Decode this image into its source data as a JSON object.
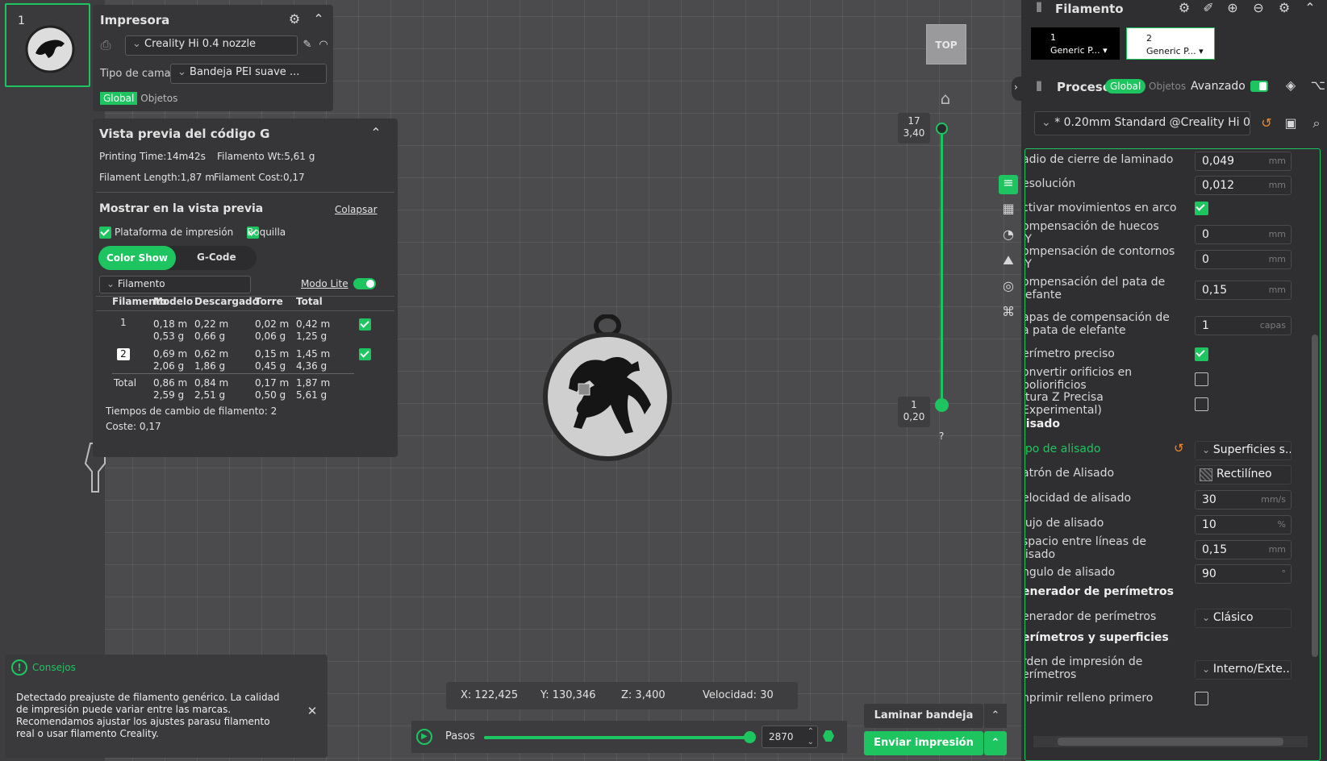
{
  "plate": {
    "number": "1"
  },
  "printer": {
    "title": "Impresora",
    "nozzle": "Creality Hi 0.4 nozzle",
    "bed_label": "Tipo de cama",
    "bed_value": "Bandeja PEI suave ...",
    "tab_global": "Global",
    "tab_objects": "Objetos"
  },
  "gcode": {
    "title": "Vista previa del código G",
    "printing_time": "Printing Time:14m42s",
    "filament_wt": "Filamento Wt:5,61 g",
    "filament_length": "Filament Length:1,87 m",
    "filament_cost": "Filament Cost:0,17",
    "show_title": "Mostrar en la vista previa",
    "collapse": "Colapsar",
    "opt_plate": "Plataforma de impresión",
    "opt_nozzle": "Boquilla",
    "tab_color": "Color Show",
    "tab_gcode": "G-Code",
    "dropdown": "Filamento",
    "lite_mode": "Modo Lite",
    "headers": [
      "Filamento",
      "Modelo",
      "Descargado",
      "Torre",
      "Total"
    ],
    "rows": [
      {
        "id": "1",
        "modelo": [
          "0,18 m",
          "0,53 g"
        ],
        "descargado": [
          "0,22 m",
          "0,66 g"
        ],
        "torre": [
          "0,02 m",
          "0,06 g"
        ],
        "total": [
          "0,42 m",
          "1,25 g"
        ]
      },
      {
        "id": "2",
        "modelo": [
          "0,69 m",
          "2,06 g"
        ],
        "descargado": [
          "0,62 m",
          "1,86 g"
        ],
        "torre": [
          "0,15 m",
          "0,45 g"
        ],
        "total": [
          "1,45 m",
          "4,36 g"
        ]
      }
    ],
    "total_row": {
      "label": "Total",
      "modelo": [
        "0,86 m",
        "2,59 g"
      ],
      "descargado": [
        "0,84 m",
        "2,51 g"
      ],
      "torre": [
        "0,17 m",
        "0,50 g"
      ],
      "total": [
        "1,87 m",
        "5,61 g"
      ]
    },
    "change_times": "Tiempos de cambio de filamento:  2",
    "cost": "Coste:  0,17"
  },
  "tips": {
    "title": "Consejos",
    "text": "Detectado preajuste de filamento genérico. La calidad de impresión puede variar entre las marcas. Recomendamos ajustar los ajustes parasu filamento real o usar filamento Creality."
  },
  "view": {
    "top_label": "TOP",
    "layer_top": [
      "17",
      "3,40"
    ],
    "layer_bottom": [
      "1",
      "0,20"
    ],
    "question": "?"
  },
  "status": {
    "x": "X: 122,425",
    "y": "Y: 130,346",
    "z": "Z: 3,400",
    "speed": "Velocidad: 30"
  },
  "steps": {
    "label": "Pasos",
    "value": "2870",
    "progress": 1.0
  },
  "actions": {
    "slice": "Laminar bandeja",
    "send": "Enviar impresión"
  },
  "right": {
    "filament_title": "Filamento",
    "filament_slots": [
      {
        "num": "1",
        "name": "Generic P..."
      },
      {
        "num": "2",
        "name": "Generic P..."
      }
    ],
    "process_title": "Proceso",
    "tab_global": "Global",
    "tab_objects": "Objetos",
    "advanced": "Avanzado",
    "preset": "* 0.20mm Standard @Creality Hi 0...",
    "settings": [
      {
        "label": "adio de cierre de laminado",
        "value": "0,049",
        "unit": "mm"
      },
      {
        "label": "esolución",
        "value": "0,012",
        "unit": "mm"
      },
      {
        "label": "ctivar movimientos en arco",
        "check": true
      },
      {
        "label": "ompensación de huecos\n-Y",
        "value": "0",
        "unit": "mm"
      },
      {
        "label": "ompensación de contornos\n-Y",
        "value": "0",
        "unit": "mm"
      },
      {
        "label": "ompensación del pata de\nlefante",
        "value": "0,15",
        "unit": "mm"
      },
      {
        "label": "apas de compensación de\na pata de elefante",
        "value": "1",
        "unit": "capas"
      },
      {
        "label": "erímetro preciso",
        "check": true
      },
      {
        "label": "onvertir orificios en\npoliorificios",
        "check": false
      },
      {
        "label": "ltura Z Precisa\nExperimental)",
        "check": false
      }
    ],
    "section_ironing": "lisado",
    "ironing": [
      {
        "label": "ipo de alisado",
        "select": "Superficies s..."
      },
      {
        "label": "atrón de Alisado",
        "select": "Rectilíneo"
      },
      {
        "label": "elocidad de alisado",
        "value": "30",
        "unit": "mm/s"
      },
      {
        "label": "lujo de alisado",
        "value": "10",
        "unit": "%"
      },
      {
        "label": "spacio entre líneas de\nlisado",
        "value": "0,15",
        "unit": "mm"
      },
      {
        "label": "ngulo de alisado",
        "value": "90",
        "unit": "°"
      }
    ],
    "section_wall_gen": "enerador de perímetros",
    "wall_gen": {
      "label": "enerador de perímetros",
      "select": "Clásico"
    },
    "section_walls": "erímetros y superficies",
    "wall_order": {
      "label": "rden de impresión de\nerímetros",
      "select": "Interno/Exte..."
    },
    "infill_first": {
      "label": "nprimir relleno primero",
      "check": false
    }
  },
  "colors": {
    "accent": "#1ec460",
    "panel": "#363638",
    "background": "#4b4b4d",
    "ironing_label": "#1ec460"
  }
}
